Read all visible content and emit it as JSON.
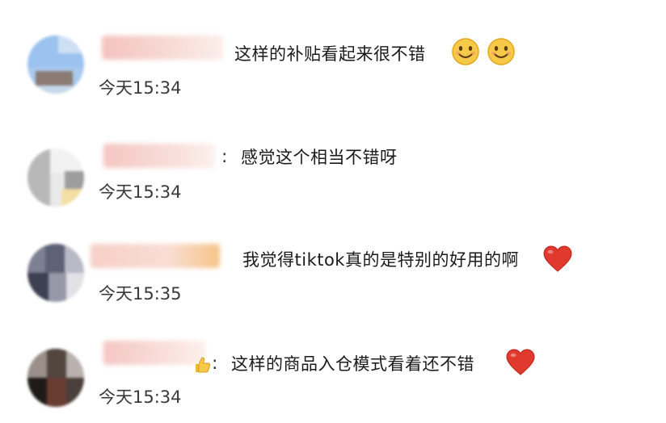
{
  "comments": [
    {
      "text": "这样的补贴看起来很不错",
      "time": "今天15:34",
      "emojis": [
        "smile-emoji",
        "smile-emoji"
      ]
    },
    {
      "text": "感觉这个相当不错呀",
      "time": "今天15:34",
      "emojis": []
    },
    {
      "text": "我觉得tiktok真的是特别的好用的啊",
      "time": "今天15:35",
      "emojis": [
        "heart-emoji"
      ]
    },
    {
      "text": "这样的商品入仓模式看着还不错",
      "time": "今天15:34",
      "emojis": [
        "heart-emoji"
      ]
    }
  ],
  "colors": {
    "emoji_face": "#f7c948",
    "heart": "#e03a2f",
    "name_blur": "#f6c9c4"
  }
}
